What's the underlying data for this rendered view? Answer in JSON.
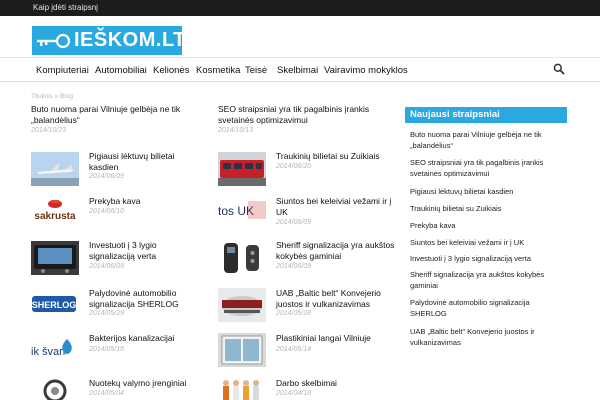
{
  "topbar": {
    "link": "Kaip įdėti straipsnį"
  },
  "logo": {
    "text": "IEŠKOM.LT"
  },
  "nav": {
    "items": [
      "Kompiuteriai",
      "Automobiliai",
      "Kelionės",
      "Kosmetika",
      "Teisė",
      "Skelbimai",
      "Vairavimo mokyklos"
    ]
  },
  "breadcrumb": "Titulinis » Blog",
  "posts": [
    {
      "title": "Buto nuoma parai Vilniuje gelbėja ne tik „balandėlius“",
      "date": "2014/10/23"
    },
    {
      "title": "SEO straipsniai yra tik pagalbinis įrankis svetainės optimizavimui",
      "date": "2014/10/13"
    },
    {
      "title": "Pigiausi lėktuvų bilietai kasdien",
      "date": "2014/06/09"
    },
    {
      "title": "Traukinių bilietai su Zuikiais",
      "date": "2014/06/20"
    },
    {
      "title": "Prekyba kava",
      "date": "2014/06/10"
    },
    {
      "title": "Siuntos bei keleiviai vežami ir į UK",
      "date": "2014/06/09"
    },
    {
      "title": "Investuoti į 3 lygio signalizaciją verta",
      "date": "2014/06/09"
    },
    {
      "title": "Sheriff signalizacija yra aukštos kokybės gaminiai",
      "date": "2014/06/09"
    },
    {
      "title": "Palydovinė automobilio signalizacija SHERLOG",
      "date": "2014/05/29"
    },
    {
      "title": "UAB „Baltic belt“ Konvejerio juostos ir vulkanizavimas",
      "date": "2014/05/28"
    },
    {
      "title": "Bakterijos kanalizacijai",
      "date": "2014/05/16"
    },
    {
      "title": "Plastikiniai langai Vilniuje",
      "date": "2014/05/14"
    },
    {
      "title": "Nuotekų valymo įrenginiai",
      "date": "2014/05/04"
    },
    {
      "title": "Darbo skelbimai",
      "date": "2014/04/18"
    }
  ],
  "thumbs": {
    "sakrusta": "sakrusta",
    "uk": "tos UK",
    "sherlog": "SHERLOG",
    "svari": "ik švari"
  },
  "sidebar": {
    "heading": "Naujausi straipsniai",
    "items": [
      "Buto nuoma parai Vilniuje gelbėja ne tik „balandėlius“",
      "SEO straipsniai yra tik pagalbinis įrankis svetainės optimizavimui",
      "Pigiausi lėktuvų bilietai kasdien",
      "Traukinių bilietai su Zuikiais",
      "Prekyba kava",
      "Siuntos bei keleiviai vežami ir į UK",
      "Investuoti į 3 lygio signalizaciją verta",
      "Sheriff signalizacija yra aukštos kokybės gaminiai",
      "Palydovinė automobilio signalizacija SHERLOG",
      "UAB „Baltic belt“ Konvejerio juostos ir vulkanizavimas"
    ]
  },
  "colors": {
    "accent": "#29a9df",
    "topbar": "#1c1c1c"
  }
}
